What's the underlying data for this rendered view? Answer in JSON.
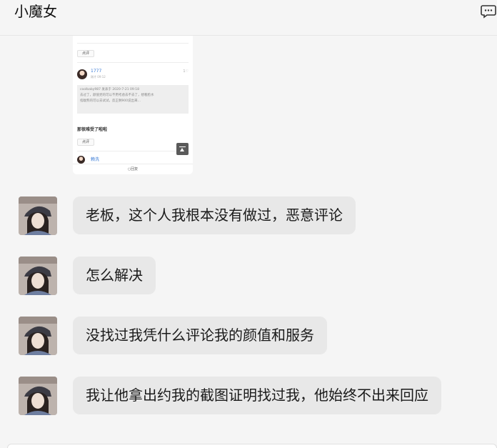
{
  "header": {
    "title": "小魔女"
  },
  "screenshot": {
    "chip_label": "点评",
    "commenter_name": "1777",
    "commenter_time": "刚才 09:12",
    "likes": "1♡",
    "quote_line1": "coolbaby987 发表于 2020-7-21 09:18",
    "quote_line2": "去过了，颜值党的可以不用考虑去不去了，想看脸水",
    "quote_line3": "指耽熊的可以去试试，反正剩900说出来...",
    "post_text": "那很难受了啦啦",
    "chip_label_2": "点评",
    "next_name": "赖洗",
    "reply_label": "回复"
  },
  "messages": [
    {
      "text": "老板，这个人我根本没有做过，恶意评论"
    },
    {
      "text": "怎么解决"
    },
    {
      "text": "没找过我凭什么评论我的颜值和服务"
    },
    {
      "text": "我让他拿出约我的截图证明找过我，他始终不出来回应"
    }
  ]
}
